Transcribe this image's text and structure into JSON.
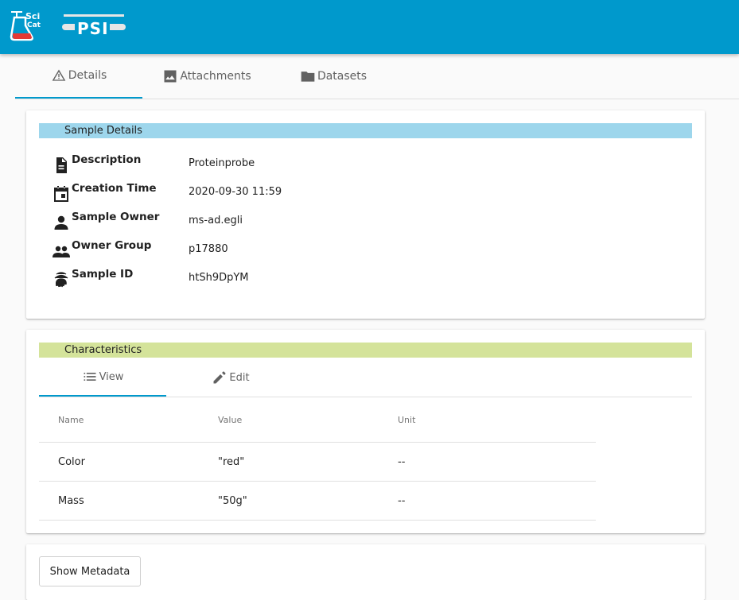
{
  "tabs": [
    {
      "label": "Details",
      "icon": "warning-icon"
    },
    {
      "label": "Attachments",
      "icon": "image-icon"
    },
    {
      "label": "Datasets",
      "icon": "folder-icon"
    }
  ],
  "sample_details": {
    "header": "Sample Details",
    "header_color": "#9dd6ec",
    "rows": [
      {
        "label": "Description",
        "value": "Proteinprobe",
        "icon": "description-icon"
      },
      {
        "label": "Creation Time",
        "value": "2020-09-30 11:59",
        "icon": "calendar-icon"
      },
      {
        "label": "Sample Owner",
        "value": "ms-ad.egli",
        "icon": "person-icon"
      },
      {
        "label": "Owner Group",
        "value": "p17880",
        "icon": "group-icon"
      },
      {
        "label": "Sample ID",
        "value": "htSh9DpYM",
        "icon": "fingerprint-icon"
      }
    ]
  },
  "characteristics": {
    "header": "Characteristics",
    "header_color": "#d4e39a",
    "tabs": [
      {
        "label": "View",
        "icon": "list-icon"
      },
      {
        "label": "Edit",
        "icon": "pencil-icon"
      }
    ],
    "columns": [
      "Name",
      "Value",
      "Unit"
    ],
    "rows": [
      {
        "name": "Color",
        "value": "\"red\"",
        "unit": "--"
      },
      {
        "name": "Mass",
        "value": "\"50g\"",
        "unit": "--"
      }
    ]
  },
  "metadata": {
    "button_label": "Show Metadata"
  },
  "colors": {
    "topbar": "#0099cc",
    "accent": "#0099cc"
  }
}
